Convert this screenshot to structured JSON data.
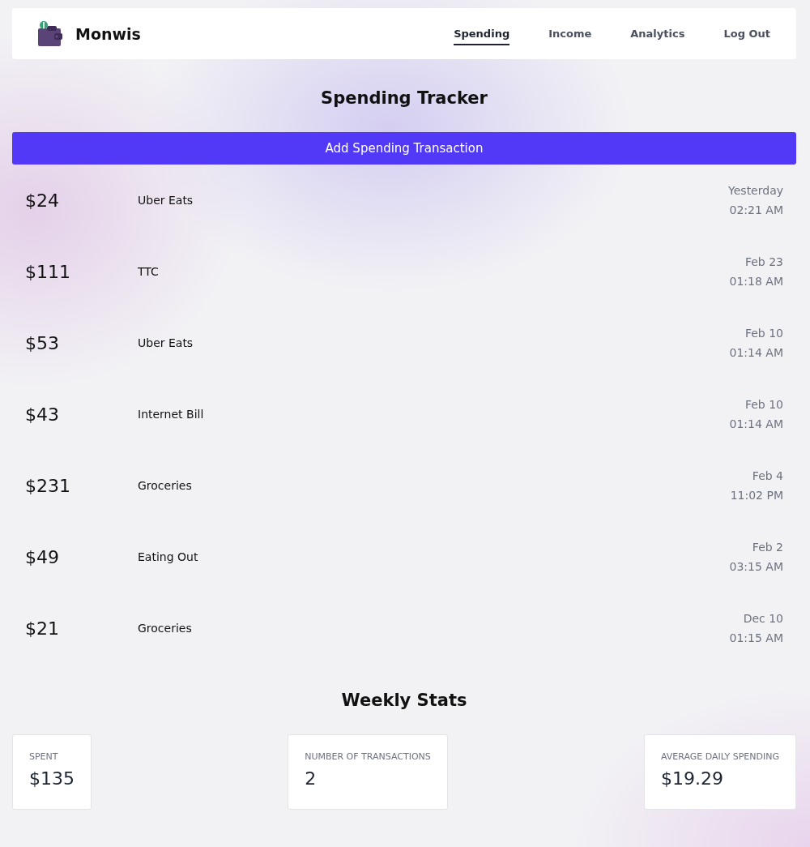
{
  "brand": {
    "name": "Monwis"
  },
  "nav": [
    {
      "label": "Spending",
      "selected": true
    },
    {
      "label": "Income",
      "selected": false
    },
    {
      "label": "Analytics",
      "selected": false
    },
    {
      "label": "Log Out",
      "selected": false
    }
  ],
  "title": "Spending Tracker",
  "add_button": "Add Spending Transaction",
  "transactions": [
    {
      "amount": "$24",
      "description": "Uber Eats",
      "date": "Yesterday",
      "time": "02:21 AM"
    },
    {
      "amount": "$111",
      "description": "TTC",
      "date": "Feb 23",
      "time": "01:18 AM"
    },
    {
      "amount": "$53",
      "description": "Uber Eats",
      "date": "Feb 10",
      "time": "01:14 AM"
    },
    {
      "amount": "$43",
      "description": "Internet Bill",
      "date": "Feb 10",
      "time": "01:14 AM"
    },
    {
      "amount": "$231",
      "description": "Groceries",
      "date": "Feb 4",
      "time": "11:02 PM"
    },
    {
      "amount": "$49",
      "description": "Eating Out",
      "date": "Feb 2",
      "time": "03:15 AM"
    },
    {
      "amount": "$21",
      "description": "Groceries",
      "date": "Dec 10",
      "time": "01:15 AM"
    }
  ],
  "stats_title": "Weekly Stats",
  "stats": [
    {
      "label": "SPENT",
      "value": "$135"
    },
    {
      "label": "NUMBER OF TRANSACTIONS",
      "value": "2"
    },
    {
      "label": "AVERAGE DAILY SPENDING",
      "value": "$19.29"
    }
  ]
}
